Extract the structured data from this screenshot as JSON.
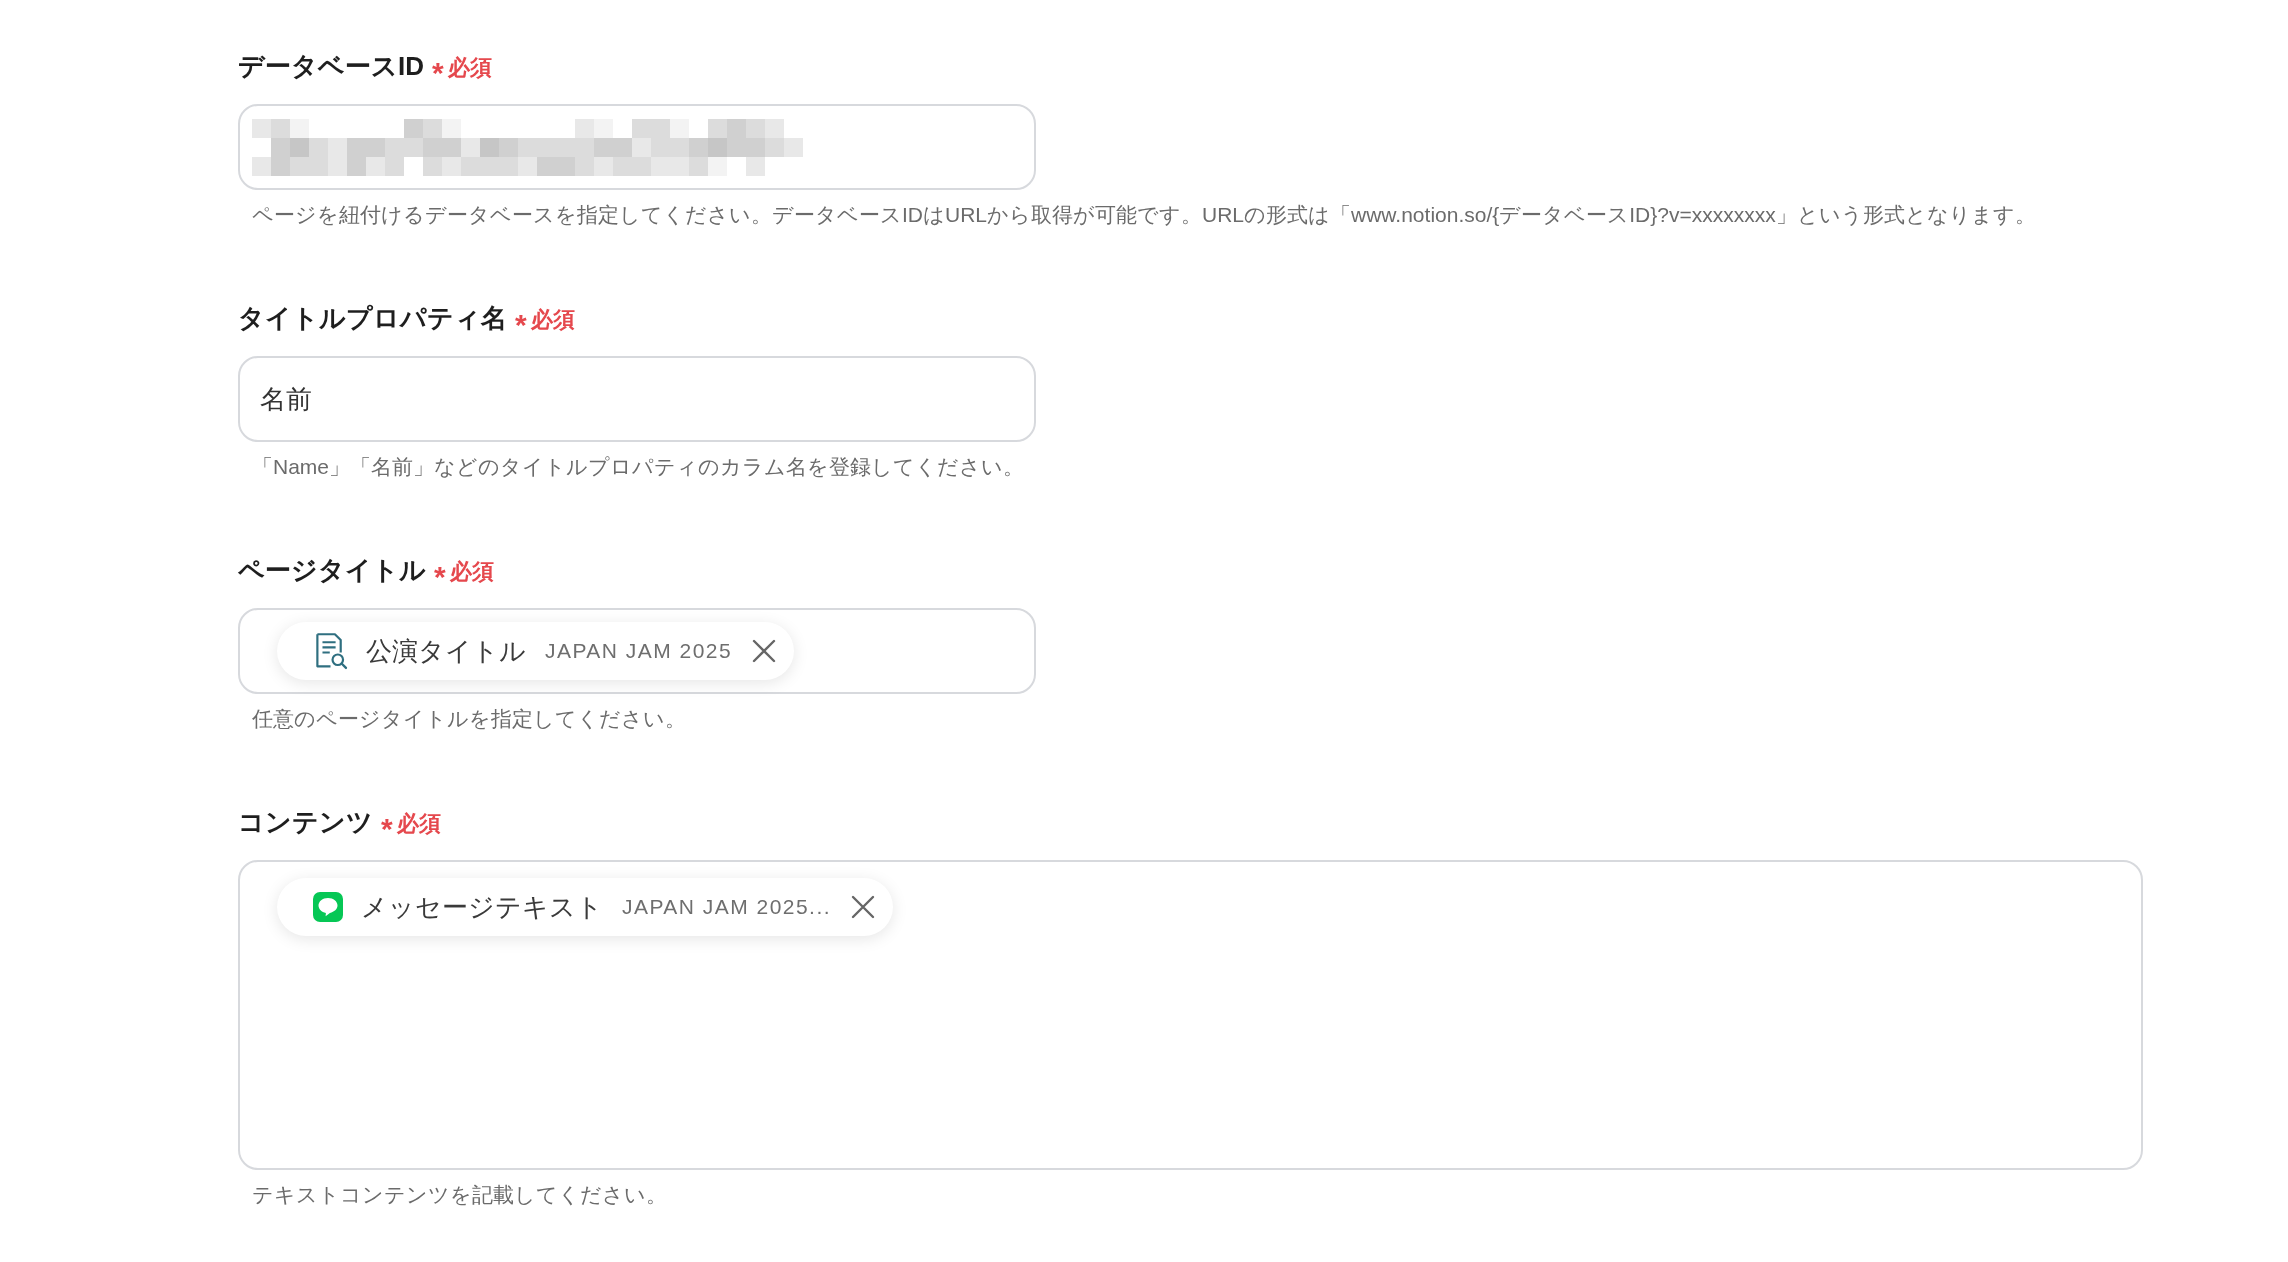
{
  "fields": [
    {
      "label": "データベースID",
      "required_mark": "*",
      "required_text": "必須",
      "input": {
        "kind": "redacted",
        "multiline": false
      },
      "hint": "ページを紐付けるデータベースを指定してください。データベースIDはURLから取得が可能です。URLの形式は「www.notion.so/{データベースID}?v=xxxxxxxx」という形式となります。"
    },
    {
      "label": "タイトルプロパティ名",
      "required_mark": "*",
      "required_text": "必須",
      "input": {
        "kind": "text",
        "multiline": false,
        "value": "名前"
      },
      "hint": "「Name」「名前」などのタイトルプロパティのカラム名を登録してください。"
    },
    {
      "label": "ページタイトル",
      "required_mark": "*",
      "required_text": "必須",
      "input": {
        "kind": "chips",
        "multiline": false,
        "chips": [
          {
            "kind": "document",
            "name": "公演タイトル",
            "value": "JAPAN JAM 2025"
          }
        ]
      },
      "hint": "任意のページタイトルを指定してください。"
    },
    {
      "label": "コンテンツ",
      "required_mark": "*",
      "required_text": "必須",
      "input": {
        "kind": "chips",
        "multiline": true,
        "chips": [
          {
            "kind": "messenger",
            "name": "メッセージテキスト",
            "value": "JAPAN JAM 2025..."
          }
        ]
      },
      "hint": "テキストコンテンツを記載してください。"
    }
  ]
}
